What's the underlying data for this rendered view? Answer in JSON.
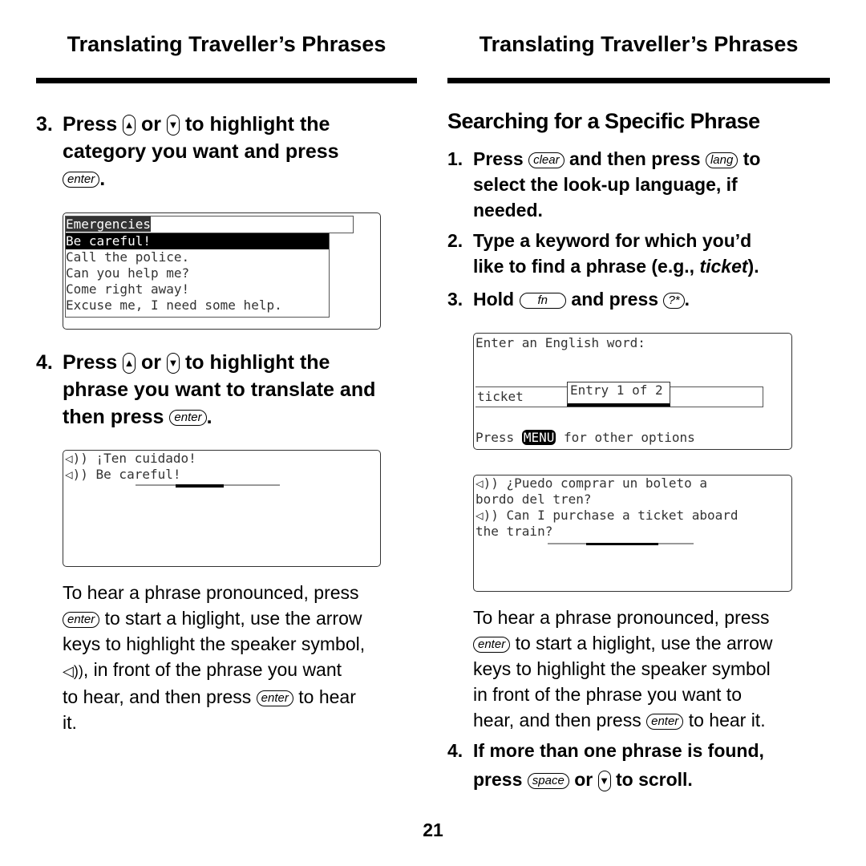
{
  "left": {
    "heading": "Translating Traveller’s Phrases",
    "step3": {
      "num": "3.",
      "press": "Press",
      "or": "or",
      "text1": "to highlight the",
      "text2": "category you want and press",
      "key": "enter",
      "end": "."
    },
    "screen1": {
      "title": "Emergencies",
      "items": [
        "Be careful!",
        "Call the police.",
        "Can you help me?",
        "Come right away!",
        "Excuse me, I need some help."
      ]
    },
    "step4": {
      "num": "4.",
      "press": "Press",
      "or": "or",
      "text1": "to highlight the",
      "text2": "phrase you want to translate and",
      "text3": "then press",
      "key": "enter",
      "end": "."
    },
    "screen2": {
      "lines": [
        "\u0001 ¡Ten cuidado!",
        "\u0001 Be careful!"
      ]
    },
    "para": {
      "l1": "To hear a phrase pronounced, press",
      "key1": "enter",
      "l2": "to start a higlight, use the arrow",
      "l3": "keys to highlight the speaker symbol,",
      "l4": ", in front of the phrase you want",
      "l5": "to hear, and then press",
      "key2": "enter",
      "l6": "to hear",
      "l7": "it."
    }
  },
  "right": {
    "heading": "Translating Traveller’s Phrases",
    "section_title": "Searching for a Specific Phrase",
    "step1": {
      "num": "1.",
      "press": "Press",
      "key1": "clear",
      "mid": "and then press",
      "key2": "lang",
      "to": "to",
      "l2": "select the look-up language, if",
      "l3": "needed."
    },
    "step2": {
      "num": "2.",
      "l1": "Type a keyword for which you’d",
      "l2": "like to find a phrase (e.g.,",
      "example": "ticket",
      "end": ")."
    },
    "step3": {
      "num": "3.",
      "hold": "Hold",
      "key1": "fn",
      "mid": "and press",
      "key2": "?*",
      "end": "."
    },
    "screen3": {
      "prompt": "Enter an English word:",
      "input": "ticket",
      "popup": "Entry 1 of 2",
      "footer_pre": "Press",
      "footer_key": "MENU",
      "footer_post": "for other options"
    },
    "screen4": {
      "lines": [
        "◁)) ¿Puedo comprar un boleto a",
        "bordo del tren?",
        "◁)) Can I purchase a ticket aboard",
        "the train?"
      ]
    },
    "para": {
      "l1": "To hear a phrase pronounced, press",
      "key1": "enter",
      "l2": "to start a higlight, use the arrow",
      "l3": "keys to highlight the speaker symbol",
      "l4": "in front of the phrase you want to",
      "l5": "hear, and then press",
      "key2": "enter",
      "l6": "to hear it."
    },
    "step4": {
      "num": "4.",
      "l1": "If more than one phrase is found,",
      "press": "press",
      "key": "space",
      "or": "or",
      "end": "to scroll."
    }
  },
  "page_number": "21",
  "icons": {
    "up": "up-arrow-key-icon",
    "down": "down-arrow-key-icon",
    "speaker": "speaker-icon"
  }
}
